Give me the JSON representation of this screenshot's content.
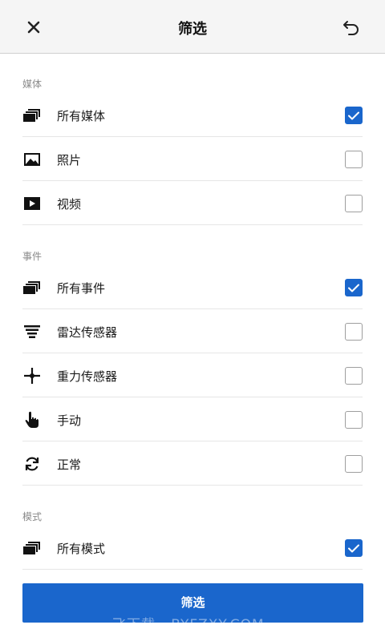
{
  "header": {
    "title": "筛选"
  },
  "sections": [
    {
      "label": "媒体",
      "items": [
        {
          "label": "所有媒体",
          "icon": "stack-icon",
          "checked": true
        },
        {
          "label": "照片",
          "icon": "photo-icon",
          "checked": false
        },
        {
          "label": "视频",
          "icon": "video-icon",
          "checked": false
        }
      ]
    },
    {
      "label": "事件",
      "items": [
        {
          "label": "所有事件",
          "icon": "stack-icon",
          "checked": true
        },
        {
          "label": "雷达传感器",
          "icon": "radar-icon",
          "checked": false
        },
        {
          "label": "重力传感器",
          "icon": "gravity-icon",
          "checked": false
        },
        {
          "label": "手动",
          "icon": "hand-pointer-icon",
          "checked": false
        },
        {
          "label": "正常",
          "icon": "refresh-icon",
          "checked": false
        }
      ]
    },
    {
      "label": "模式",
      "items": [
        {
          "label": "所有模式",
          "icon": "stack-icon",
          "checked": true
        }
      ]
    }
  ],
  "apply_button": "筛选",
  "watermark": "飞下载 · BYFZXY.COM",
  "colors": {
    "accent": "#1a66cc",
    "header_bg": "#f5f5f5"
  }
}
